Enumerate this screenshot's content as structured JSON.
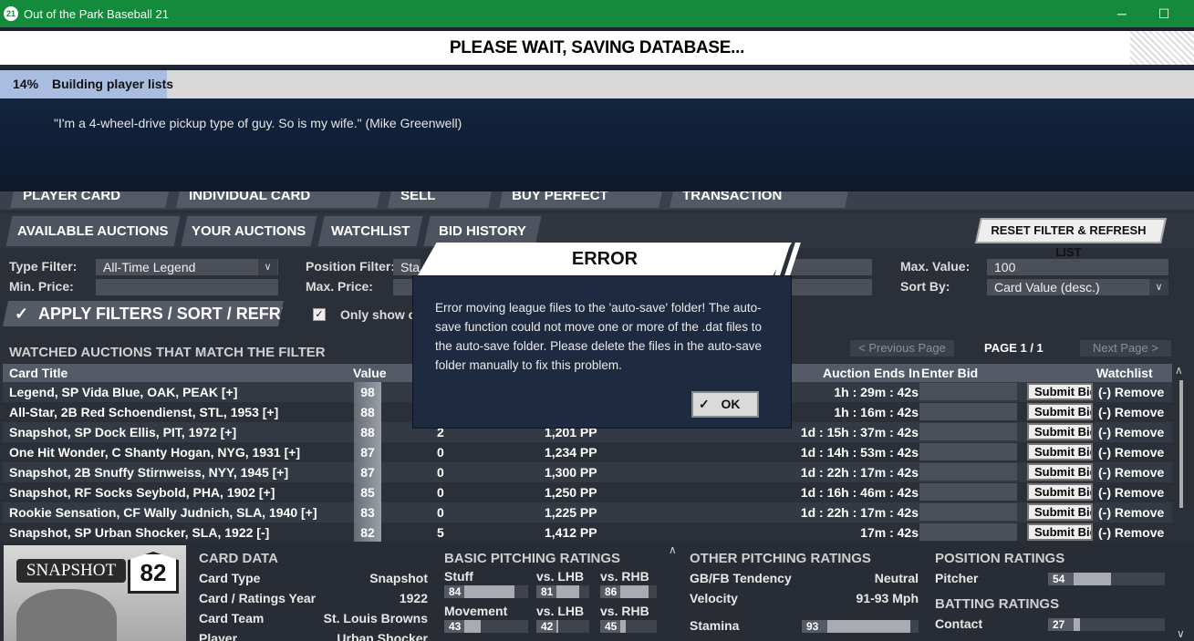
{
  "window": {
    "app_icon": "21",
    "title": "Out of the Park Baseball 21",
    "minimize": "─",
    "maximize": "☐"
  },
  "save": {
    "title": "PLEASE WAIT, SAVING DATABASE...",
    "percent": "14%",
    "progress": 0.14,
    "status": "Building player lists",
    "quote": "\"I'm a 4-wheel-drive pickup type of guy. So is my wife.\" (Mike Greenwell)"
  },
  "top_tabs": [
    "PLAYER CARD PACKS",
    "INDIVIDUAL CARD AUCTIONS",
    "SELL CARDS",
    "BUY PERFECT POINTS",
    "TRANSACTION HISTORY"
  ],
  "sub_tabs": [
    "AVAILABLE AUCTIONS",
    "YOUR AUCTIONS",
    "WATCHLIST",
    "BID HISTORY"
  ],
  "reset_button": "RESET FILTER & REFRESH LIST",
  "filters": {
    "type_filter_label": "Type Filter:",
    "type_filter_value": "All-Time Legend",
    "min_price_label": "Min. Price:",
    "position_filter_label": "Position Filter:",
    "position_filter_value": "Sta",
    "max_price_label": "Max. Price:",
    "max_value_label": "Max. Value:",
    "max_value": "100",
    "sort_by_label": "Sort By:",
    "sort_by_value": "Card Value (desc.)",
    "apply_button": "APPLY FILTERS / SORT / REFRESH",
    "only_show_label": "Only show ca",
    "dropdown_glyph": "∨",
    "check_glyph": "✓"
  },
  "list": {
    "section_title": "WATCHED AUCTIONS THAT MATCH THE FILTER",
    "prev_page": "< Previous Page",
    "page_label": "PAGE 1 / 1",
    "next_page": "Next Page >",
    "columns": {
      "title": "Card Title",
      "value": "Value",
      "ends": "Auction Ends In",
      "bid": "Enter Bid",
      "watch": "Watchlist"
    },
    "submit_label": "Submit Bid",
    "rows": [
      {
        "title": "Legend, SP Vida Blue, OAK, PEAK  [+]",
        "value": "98",
        "bids": "",
        "price": "",
        "ends": "1h : 29m : 42s",
        "watch": "(-) Remove"
      },
      {
        "title": "All-Star, 2B Red Schoendienst, STL, 1953  [+]",
        "value": "88",
        "bids": "",
        "price": "",
        "ends": "1h : 16m : 42s",
        "watch": "(-) Remove"
      },
      {
        "title": "Snapshot, SP Dock Ellis, PIT, 1972  [+]",
        "value": "88",
        "bids": "2",
        "price": "1,201 PP",
        "ends": "1d : 15h : 37m : 42s",
        "watch": "(-) Remove"
      },
      {
        "title": "One Hit Wonder, C Shanty Hogan, NYG, 1931  [+]",
        "value": "87",
        "bids": "0",
        "price": "1,234 PP",
        "ends": "1d : 14h : 53m : 42s",
        "watch": "(-) Remove"
      },
      {
        "title": "Snapshot, 2B Snuffy Stirnweiss, NYY, 1945  [+]",
        "value": "87",
        "bids": "0",
        "price": "1,300 PP",
        "ends": "1d : 22h : 17m : 42s",
        "watch": "(-) Remove"
      },
      {
        "title": "Snapshot, RF Socks Seybold, PHA, 1902  [+]",
        "value": "85",
        "bids": "0",
        "price": "1,250 PP",
        "ends": "1d : 16h : 46m : 42s",
        "watch": "(-) Remove"
      },
      {
        "title": "Rookie Sensation, CF Wally Judnich, SLA, 1940  [+]",
        "value": "83",
        "bids": "0",
        "price": "1,225 PP",
        "ends": "1d : 22h : 17m : 42s",
        "watch": "(-) Remove"
      },
      {
        "title": "Snapshot, SP Urban Shocker, SLA, 1922  [-]",
        "value": "82",
        "bids": "5",
        "price": "1,412 PP",
        "ends": "17m : 42s",
        "watch": "(-) Remove"
      }
    ]
  },
  "card": {
    "badge": "SNAPSHOT",
    "rating": "82",
    "data_title": "CARD DATA",
    "fields": [
      {
        "label": "Card Type",
        "value": "Snapshot"
      },
      {
        "label": "Card / Ratings Year",
        "value": "1922"
      },
      {
        "label": "Card Team",
        "value": "St. Louis Browns"
      },
      {
        "label": "Player",
        "value": "Urban Shocker"
      }
    ],
    "basic_title": "BASIC PITCHING RATINGS",
    "basic": [
      {
        "label": "Stuff",
        "value": 84
      },
      {
        "label": "vs. LHB",
        "value": 81
      },
      {
        "label": "vs. RHB",
        "value": 86
      },
      {
        "label": "Movement",
        "value": 43
      },
      {
        "label": "vs. LHB",
        "value": 42
      },
      {
        "label": "vs. RHB",
        "value": 45
      }
    ],
    "other_title": "OTHER PITCHING RATINGS",
    "gbfb_label": "GB/FB Tendency",
    "gbfb_value": "Neutral",
    "velocity_label": "Velocity",
    "velocity_value": "91-93 Mph",
    "stamina_label": "Stamina",
    "stamina_value": 93,
    "position_title": "POSITION RATINGS",
    "pitcher_label": "Pitcher",
    "pitcher_value": 54,
    "batting_title": "BATTING RATINGS",
    "contact_label": "Contact",
    "contact_value": 27
  },
  "error": {
    "title": "ERROR",
    "message": "Error moving league files to the 'auto-save' folder! The auto-save function could not move one or more of the .dat files to the auto-save folder. Please delete the files in the auto-save folder manually to fix this problem.",
    "ok": "OK",
    "ok_check": "✓"
  },
  "scroll": {
    "up": "∧",
    "down": "∨"
  }
}
